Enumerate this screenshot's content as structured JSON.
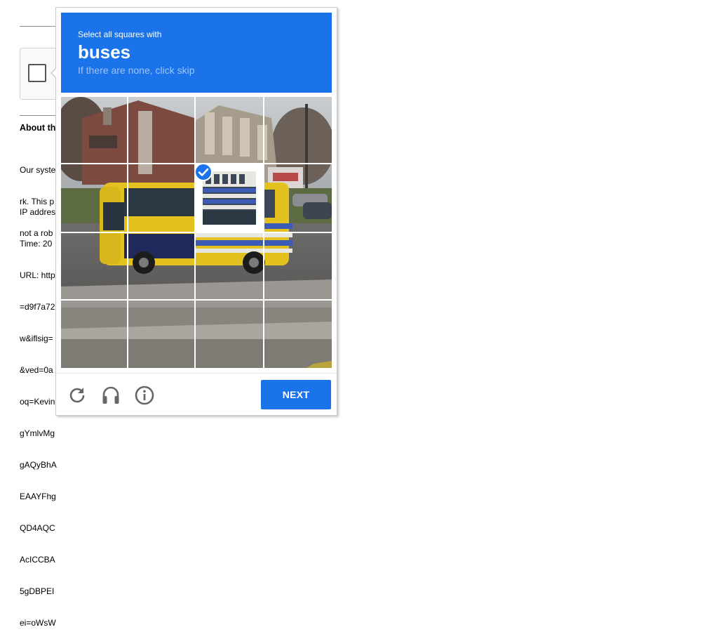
{
  "background_page": {
    "heading": "About th",
    "paragraph_lines": [
      "Our syste",
      "rk. This p",
      "not a rob"
    ],
    "detail_lines": [
      "IP addres",
      "Time: 20",
      "URL: http",
      "=d9f7a72",
      "w&iflsig=",
      "&ved=0a",
      "oq=Kevin",
      "gYmlvMg",
      "gAQyBhA",
      "EAAYFhg",
      "QD4AQC",
      "AcICCBA",
      "5gDBPEI",
      "ei=oWsW"
    ]
  },
  "challenge": {
    "instruction": "Select all squares with",
    "target": "buses",
    "hint": "If there are none, click skip",
    "header_color": "#1a73e8",
    "grid": {
      "rows": 4,
      "cols": 4,
      "selected_tiles": [
        6
      ]
    },
    "footer": {
      "reload_icon": "reload-icon",
      "audio_icon": "headphones-icon",
      "info_icon": "info-icon",
      "next_label": "NEXT"
    }
  }
}
